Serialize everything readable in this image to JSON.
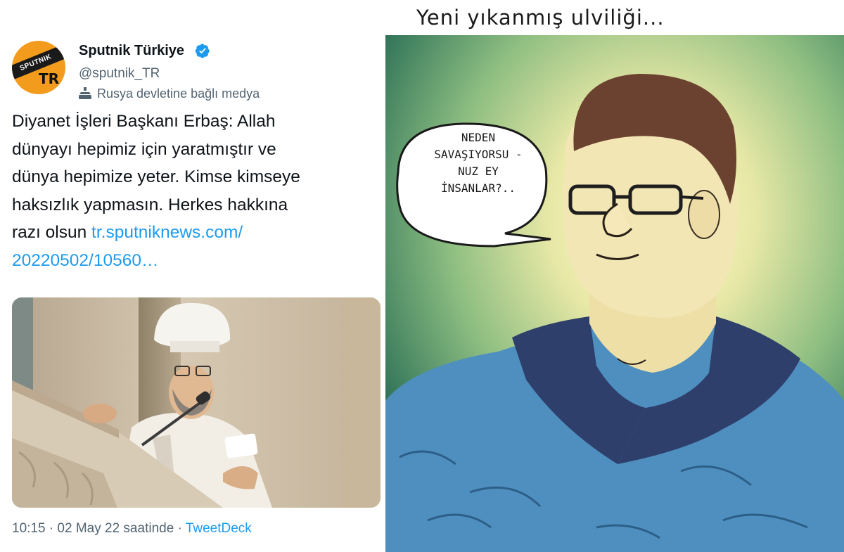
{
  "tweet": {
    "account_name": "Sputnik Türkiye",
    "handle": "@sputnik_TR",
    "state_label": "Rusya devletine bağlı medya",
    "avatar_text": {
      "top": "SPUTNIK",
      "bottom": "TR"
    },
    "text_lines": [
      "Diyanet İşleri Başkanı Erbaş: Allah",
      "dünyayı hepimiz için yaratmıştır ve",
      "dünya hepimize yeter. Kimse kimseye",
      "haksızlık yapmasın. Herkes hakkına",
      "razı olsun"
    ],
    "link_line1": "tr.sputniknews.com/",
    "link_line2": "20220502/10560…",
    "timestamp": "10:15 · 02 May 22 saatinde · ",
    "source": "TweetDeck",
    "colors": {
      "link": "#1d9bf0",
      "verified": "#1d9bf0",
      "avatar": "#f39b1d"
    },
    "icons": [
      "verified-badge-icon",
      "state-media-icon"
    ]
  },
  "cartoon": {
    "caption": "Yeni yıkanmış ulviliği...",
    "speech_lines": [
      "NEDEN",
      "SAVAŞIYORSU -",
      "NUZ EY",
      "İNSANLAR?.."
    ]
  }
}
